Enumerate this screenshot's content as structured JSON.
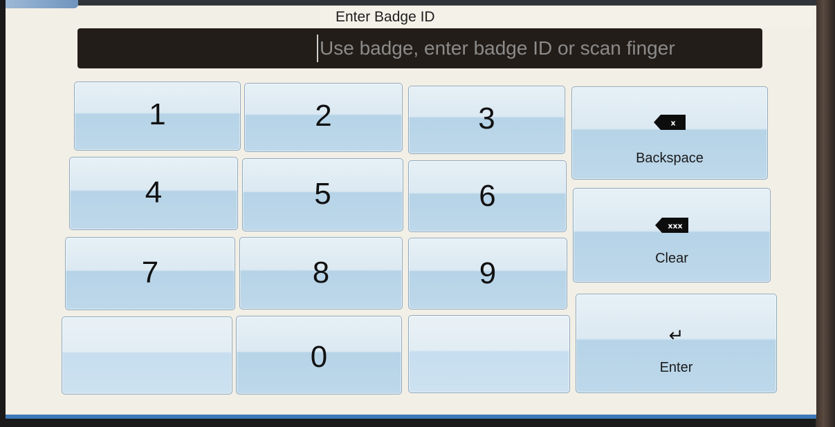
{
  "header": {
    "title": "Enter Badge ID"
  },
  "input": {
    "placeholder": "Use badge, enter badge ID or scan finger",
    "value": ""
  },
  "keypad": {
    "keys": [
      "1",
      "2",
      "3",
      "4",
      "5",
      "6",
      "7",
      "8",
      "9",
      "",
      "0",
      ""
    ]
  },
  "actions": {
    "backspace": {
      "label": "Backspace",
      "icon": "backspace-icon",
      "glyph": "x"
    },
    "clear": {
      "label": "Clear",
      "icon": "clear-icon",
      "glyph": "xxx"
    },
    "enter": {
      "label": "Enter",
      "icon": "enter-icon",
      "glyph": "↵"
    }
  },
  "colors": {
    "key_top": "#dce9f2",
    "key_bottom": "#b6d3e7",
    "input_bg": "#231d19",
    "screen_bg": "#f2efe6"
  }
}
